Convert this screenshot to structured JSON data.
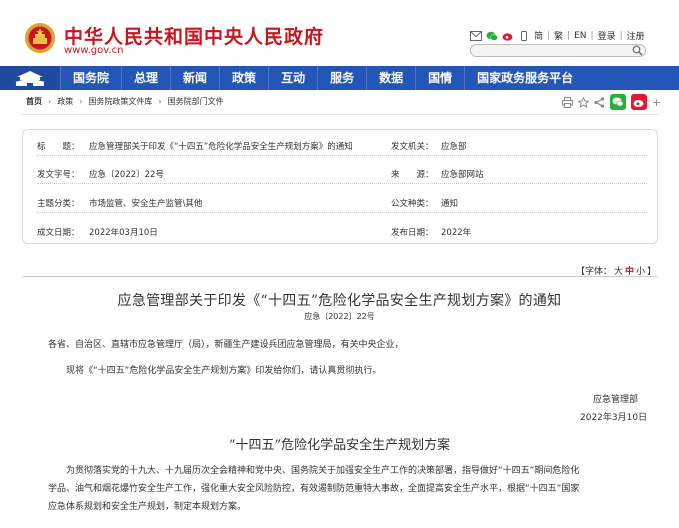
{
  "site": {
    "title": "中华人民共和国中央人民政府",
    "url": "www.gov.cn",
    "links": [
      "简",
      "繁",
      "EN",
      "登录",
      "注册"
    ]
  },
  "nav": {
    "items": [
      "国务院",
      "总理",
      "新闻",
      "政策",
      "互动",
      "服务",
      "数据",
      "国情",
      "国家政务服务平台"
    ]
  },
  "breadcrumb": [
    "首页",
    "政策",
    "国务院政策文件库",
    "国务院部门文件"
  ],
  "info": {
    "rows": [
      {
        "l1": "标　　题：",
        "v1": "应急管理部关于印发《“十四五”危险化学品安全生产规划方案》的通知",
        "l2": "发文机关：",
        "v2": "应急部"
      },
      {
        "l1": "发文字号：",
        "v1": "应急〔2022〕22号",
        "l2": "来　　源：",
        "v2": "应急部网站"
      },
      {
        "l1": "主题分类：",
        "v1": "市场监管、安全生产监管\\其他",
        "l2": "公文种类：",
        "v2": "通知"
      },
      {
        "l1": "成文日期：",
        "v1": "2022年03月10日",
        "l2": "发布日期：",
        "v2": "2022年"
      }
    ]
  },
  "font_size": {
    "prefix": "【字体：",
    "big": "大",
    "mid": "中",
    "small": "小",
    "suffix": "】"
  },
  "doc": {
    "title": "应急管理部关于印发《“十四五”危险化学品安全生产规划方案》的通知",
    "number": "应急〔2022〕22号",
    "addressee": "各省、自治区、直辖市应急管理厅（局），新疆生产建设兵团应急管理局，有关中央企业，",
    "para": "现将《“十四五”危险化学品安全生产规划方案》印发给你们，请认真贯彻执行。",
    "signer": "应急管理部",
    "date": "2022年3月10日",
    "plan_title": "“十四五”危险化学品安全生产规划方案",
    "body": [
      "为贯彻落实党的十九大、十九届历次全会精神和党中央、国务院关于加强安全生产工作的决策部署，指导做好“十四五”期间危险化",
      "学品、油气和烟花爆竹安全生产工作，强化重大安全风险防控，有效遏制防范重特大事故，全面提高安全生产水平，根据“十四五”国家",
      "应急体系规划和安全生产规划，制定本规划方案。"
    ]
  },
  "colors": {
    "brand_red": "#c8161d",
    "nav_blue": "#2456b8"
  }
}
